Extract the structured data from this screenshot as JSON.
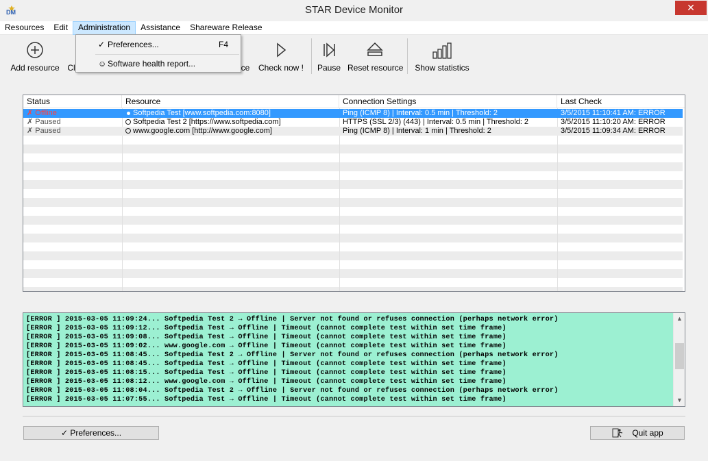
{
  "window": {
    "title": "STAR Device Monitor",
    "icon_name": "app-logo-icon",
    "close_glyph": "✕"
  },
  "menu": [
    {
      "label": "Resources"
    },
    {
      "label": "Edit"
    },
    {
      "label": "Administration"
    },
    {
      "label": "Assistance"
    },
    {
      "label": "Shareware Release"
    }
  ],
  "dropdown": {
    "items": [
      {
        "mark": "✓",
        "label": "Preferences...",
        "shortcut": "F4"
      },
      {
        "mark": "☺",
        "label": "Software health report..."
      }
    ]
  },
  "toolbar": {
    "add_resource": "Add resource",
    "partial_ci": "Cl",
    "partial_ce": "ce",
    "check_now": "Check now !",
    "pause": "Pause",
    "reset_resource": "Reset resource",
    "show_statistics": "Show statistics"
  },
  "grid": {
    "headers": [
      "Status",
      "Resource",
      "Connection Settings",
      "Last Check"
    ],
    "rows": [
      {
        "status": "✗ Offline",
        "resource": "Softpedia Test [www.softpedia.com:8080]",
        "connection": "Ping (ICMP 8) | Interval: 0.5 min | Threshold: 2",
        "last_check": "3/5/2015 11:10:41 AM: ERROR"
      },
      {
        "status": "✗ Paused",
        "resource": "Softpedia Test 2 [https://www.softpedia.com]",
        "connection": "HTTPS (SSL 2/3) (443) | Interval: 0.5 min | Threshold: 2",
        "last_check": "3/5/2015 11:10:20 AM: ERROR"
      },
      {
        "status": "✗ Paused",
        "resource": "www.google.com [http://www.google.com]",
        "connection": "Ping (ICMP 8) | Interval: 1 min | Threshold: 2",
        "last_check": "3/5/2015 11:09:34 AM: ERROR"
      }
    ]
  },
  "log": {
    "lines": [
      "[ERROR ] 2015-03-05 11:09:24... Softpedia Test 2 → Offline | Server not found or refuses connection (perhaps network error)",
      "[ERROR ] 2015-03-05 11:09:12... Softpedia Test → Offline | Timeout (cannot complete test within set time frame)",
      "[ERROR ] 2015-03-05 11:09:08... Softpedia Test → Offline | Timeout (cannot complete test within set time frame)",
      "[ERROR ] 2015-03-05 11:09:02... www.google.com → Offline | Timeout (cannot complete test within set time frame)",
      "[ERROR ] 2015-03-05 11:08:45... Softpedia Test 2 → Offline | Server not found or refuses connection (perhaps network error)",
      "[ERROR ] 2015-03-05 11:08:45... Softpedia Test → Offline | Timeout (cannot complete test within set time frame)",
      "[ERROR ] 2015-03-05 11:08:15... Softpedia Test → Offline | Timeout (cannot complete test within set time frame)",
      "[ERROR ] 2015-03-05 11:08:12... www.google.com → Offline | Timeout (cannot complete test within set time frame)",
      "[ERROR ] 2015-03-05 11:08:04... Softpedia Test 2 → Offline | Server not found or refuses connection (perhaps network error)",
      "[ERROR ] 2015-03-05 11:07:55... Softpedia Test → Offline | Timeout (cannot complete test within set time frame)"
    ]
  },
  "buttons": {
    "preferences": "✓ Preferences...",
    "quit": "Quit app"
  },
  "colors": {
    "log_bg": "#9cf0d2",
    "selection": "#3399ff",
    "offline": "#dd0000",
    "close": "#c7372f"
  }
}
